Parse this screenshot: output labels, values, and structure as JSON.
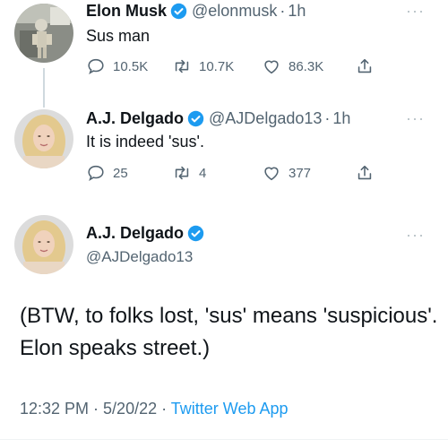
{
  "colors": {
    "accent": "#1d9bf0",
    "muted": "#536471",
    "text": "#0f1419"
  },
  "tweets": [
    {
      "name": "Elon Musk",
      "handle": "@elonmusk",
      "time": "1h",
      "text": "Sus man",
      "replies": "10.5K",
      "retweets": "10.7K",
      "likes": "86.3K",
      "avatar_icon": "robot-figure-avatar"
    },
    {
      "name": "A.J. Delgado",
      "handle": "@AJDelgado13",
      "time": "1h",
      "text": "It is indeed 'sus'.",
      "replies": "25",
      "retweets": "4",
      "likes": "377",
      "avatar_icon": "woman-portrait-avatar"
    }
  ],
  "main_tweet": {
    "name": "A.J. Delgado",
    "handle": "@AJDelgado13",
    "text": "(BTW, to folks lost, 'sus' means 'suspicious'. Elon speaks street.)",
    "timestamp": "12:32 PM · 5/20/22 · ",
    "source": "Twitter Web App"
  },
  "ui": {
    "dot": "·",
    "more": "···"
  }
}
